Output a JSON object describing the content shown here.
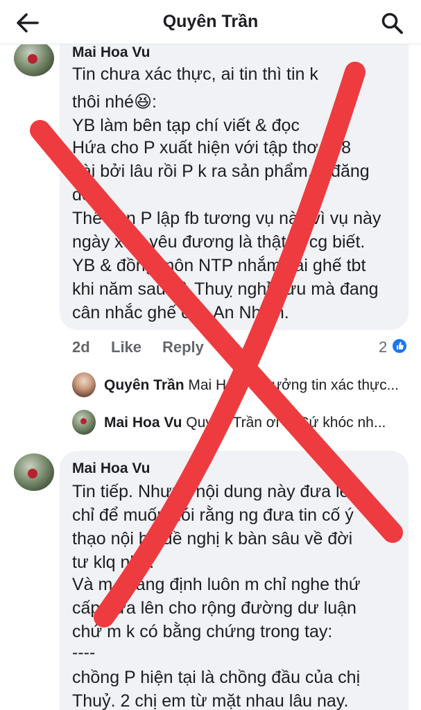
{
  "header": {
    "title": "Quyên Trần"
  },
  "comments": [
    {
      "author": "Mai Hoa Vu",
      "lines": [
        "Tin chưa xác thực, ai tin thì tin k",
        "thôi nhé😆:",
        "YB làm bên tạp chí viết & đọc",
        "Hứa cho P xuất hiện với tập thơ in 8",
        "bài bởi lâu rồi P k ra sản phẩm, k đăng",
        "đc",
        "Thế nên P lập fb tương vụ này vì vụ này",
        "ngày xưa yêu đương là thật ai cg biết.",
        "YB & đồng môn NTP nhắm cái ghế tbt",
        "khi năm sau bà Thuỵ nghỉ hưu mà đang",
        "cân nhắc ghế của An Nhiên."
      ],
      "time": "2d",
      "like_label": "Like",
      "reply_label": "Reply",
      "reaction_count": "2"
    },
    {
      "author": "Mai Hoa Vu",
      "lines": [
        "Tin tiếp. Nhưng nội dung này đưa lên",
        "chỉ để muốn nói rằng ng đưa tin cố ý",
        "thạo nội bộ đề nghị k bàn sâu về đời",
        "tư klq nhé.",
        "Và m khẳng định luôn m chỉ nghe thứ",
        "cấp đưa lên cho rộng đường dư luận",
        "chứ m k có bằng chứng trong tay:",
        "----",
        "chồng P hiện tại là chồng đầu của chị",
        "Thuỷ. 2 chị em từ mặt nhau lâu nay."
      ]
    }
  ],
  "replies": [
    {
      "name": "Quyên Trần",
      "text": "Mai Hoa Vu tưởng tin xác thực..."
    },
    {
      "name": "Mai Hoa Vu",
      "text": "Quyên Trần ơi c.  Cứ khóc nh..."
    }
  ],
  "colors": {
    "overlay_x": "#ee3b3f",
    "bubble": "#f0f2f5",
    "like_blue": "#1877f2",
    "meta_gray": "#65676b"
  },
  "icons": {
    "back": "back-arrow-icon",
    "search": "search-icon",
    "like_badge": "thumbs-up-icon"
  }
}
